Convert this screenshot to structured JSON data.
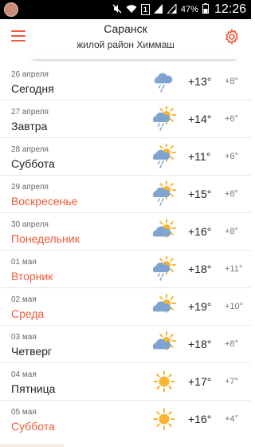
{
  "status_bar": {
    "battery_percent": "47%",
    "time": "12:26",
    "sim": "1"
  },
  "header": {
    "city": "Саранск",
    "district": "жилой район Химмаш"
  },
  "colors": {
    "accent": "#f15a38",
    "sun": "#f7b530",
    "cloud": "#7ea4cf"
  },
  "forecast": [
    {
      "date": "26 апреля",
      "day": "Сегодня",
      "weekend": false,
      "icon": "cloud-rain-icon",
      "max": "+13°",
      "min": "+8°"
    },
    {
      "date": "27 апреля",
      "day": "Завтра",
      "weekend": false,
      "icon": "partly-cloudy-rain-icon",
      "max": "+14°",
      "min": "+6°"
    },
    {
      "date": "28 апреля",
      "day": "Суббота",
      "weekend": false,
      "icon": "partly-cloudy-rain-icon",
      "max": "+11°",
      "min": "+6°"
    },
    {
      "date": "29 апреля",
      "day": "Воскресенье",
      "weekend": true,
      "icon": "partly-cloudy-rain-icon",
      "max": "+15°",
      "min": "+8°"
    },
    {
      "date": "30 апреля",
      "day": "Понедельник",
      "weekend": true,
      "icon": "partly-cloudy-icon",
      "max": "+16°",
      "min": "+8°"
    },
    {
      "date": "01 мая",
      "day": "Вторник",
      "weekend": true,
      "icon": "partly-cloudy-rain-icon",
      "max": "+18°",
      "min": "+11°"
    },
    {
      "date": "02 мая",
      "day": "Среда",
      "weekend": true,
      "icon": "partly-cloudy-icon",
      "max": "+19°",
      "min": "+10°"
    },
    {
      "date": "03 мая",
      "day": "Четверг",
      "weekend": false,
      "icon": "partly-cloudy-icon",
      "max": "+18°",
      "min": "+8°"
    },
    {
      "date": "04 мая",
      "day": "Пятница",
      "weekend": false,
      "icon": "sun-icon",
      "max": "+17°",
      "min": "+7°"
    },
    {
      "date": "05 мая",
      "day": "Суббота",
      "weekend": true,
      "icon": "sun-icon",
      "max": "+16°",
      "min": "+4°"
    }
  ]
}
